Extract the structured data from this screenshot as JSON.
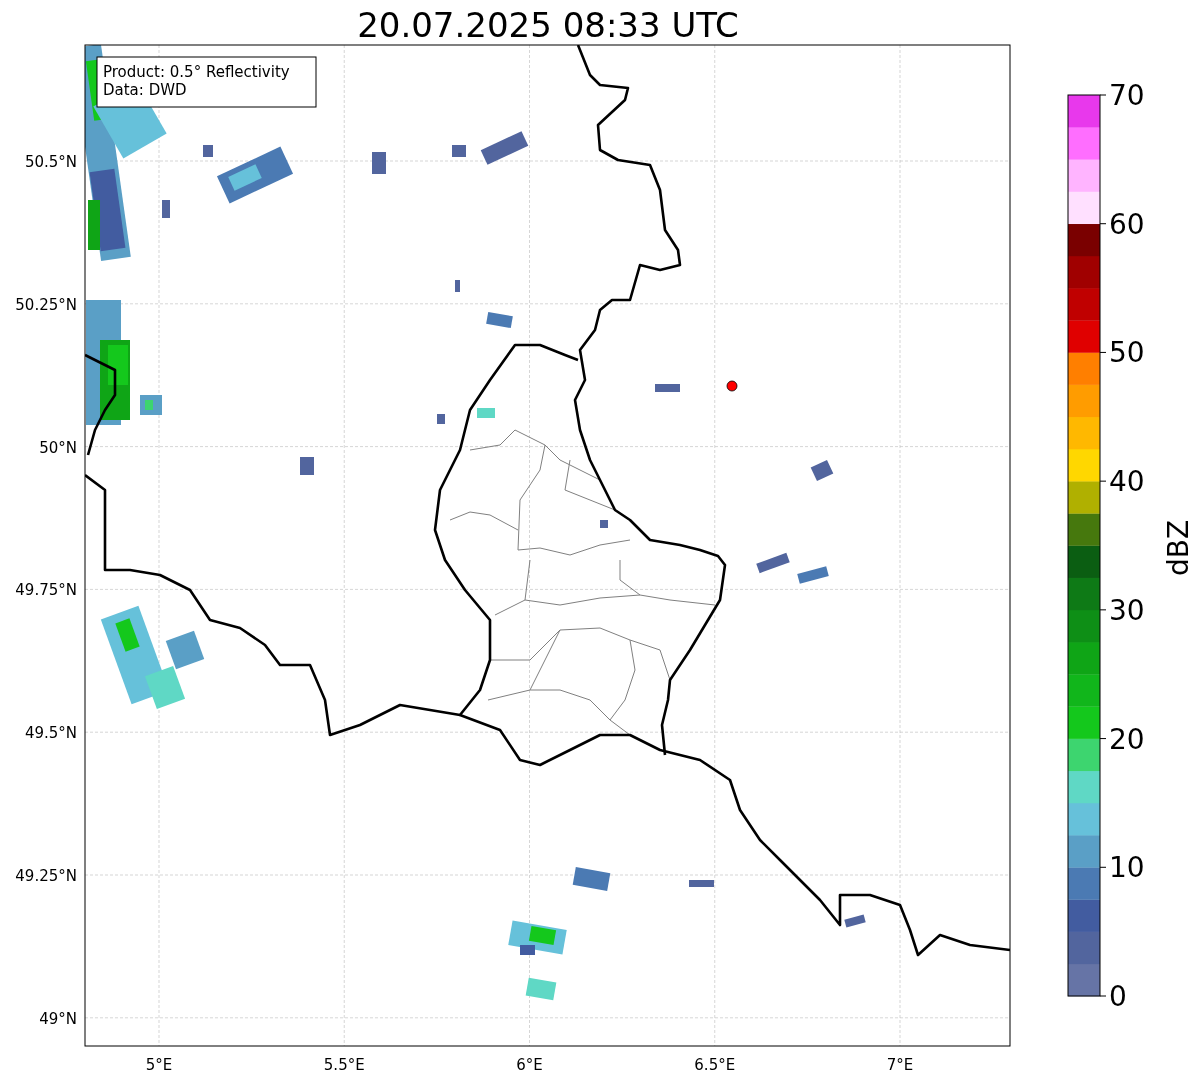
{
  "title": "20.07.2025 08:33 UTC",
  "info_box": [
    "Product: 0.5° Reflectivity",
    "Data: DWD"
  ],
  "map": {
    "lon_ticks": [
      "5°E",
      "5.5°E",
      "6°E",
      "6.5°E",
      "7°E"
    ],
    "lat_ticks": [
      "50.5°N",
      "50.25°N",
      "50°N",
      "49.75°N",
      "49.5°N",
      "49.25°N",
      "49°N"
    ]
  },
  "colorbar": {
    "label": "dBZ",
    "ticks": [
      "70",
      "60",
      "50",
      "40",
      "30",
      "20",
      "10",
      "0"
    ],
    "bins": [
      {
        "color": "#6674a6"
      },
      {
        "color": "#52659e"
      },
      {
        "color": "#425ca0"
      },
      {
        "color": "#4b7ab3"
      },
      {
        "color": "#5a9fc6"
      },
      {
        "color": "#66c1da"
      },
      {
        "color": "#5fd8c5"
      },
      {
        "color": "#3dd56f"
      },
      {
        "color": "#14c81c"
      },
      {
        "color": "#11b61b"
      },
      {
        "color": "#0fa516"
      },
      {
        "color": "#0e8f16"
      },
      {
        "color": "#0e7a16"
      },
      {
        "color": "#0b5e12"
      },
      {
        "color": "#46780d"
      },
      {
        "color": "#b0b000"
      },
      {
        "color": "#ffd700"
      },
      {
        "color": "#ffb800"
      },
      {
        "color": "#ff9c00"
      },
      {
        "color": "#ff7f00"
      },
      {
        "color": "#e00000"
      },
      {
        "color": "#c00000"
      },
      {
        "color": "#a00000"
      },
      {
        "color": "#7a0000"
      },
      {
        "color": "#ffe0ff"
      },
      {
        "color": "#ffb4ff"
      },
      {
        "color": "#ff6eff"
      },
      {
        "color": "#e838ec"
      }
    ]
  }
}
